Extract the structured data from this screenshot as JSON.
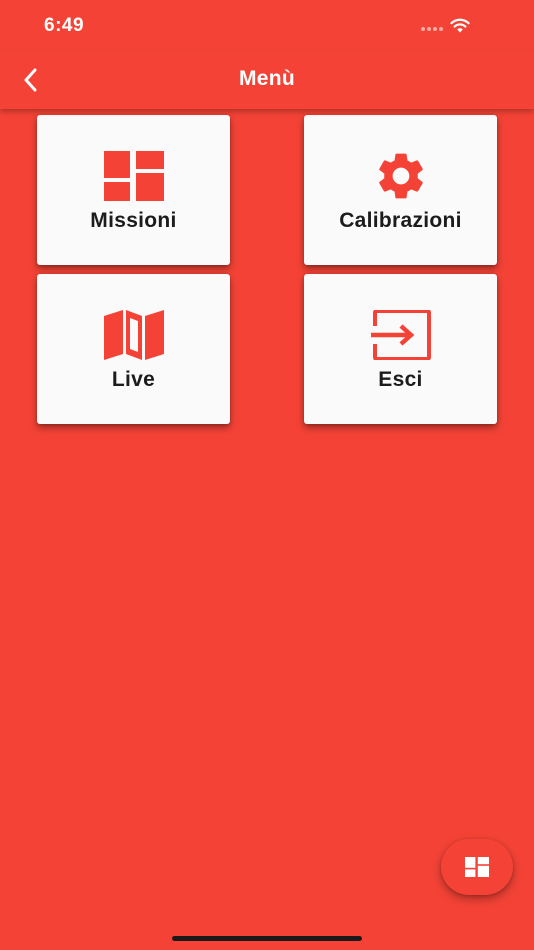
{
  "status_bar": {
    "time": "6:49"
  },
  "app_bar": {
    "title": "Menù",
    "back_icon": "chevron-left-icon"
  },
  "tiles": [
    {
      "label": "Missioni",
      "icon": "dashboard-icon"
    },
    {
      "label": "Calibrazioni",
      "icon": "gear-icon"
    },
    {
      "label": "Live",
      "icon": "map-icon"
    },
    {
      "label": "Esci",
      "icon": "exit-icon"
    }
  ],
  "fab": {
    "icon": "dashboard-icon"
  },
  "colors": {
    "primary": "#f44336",
    "tile_background": "#fafafa",
    "label_text": "#1c1c1c"
  }
}
